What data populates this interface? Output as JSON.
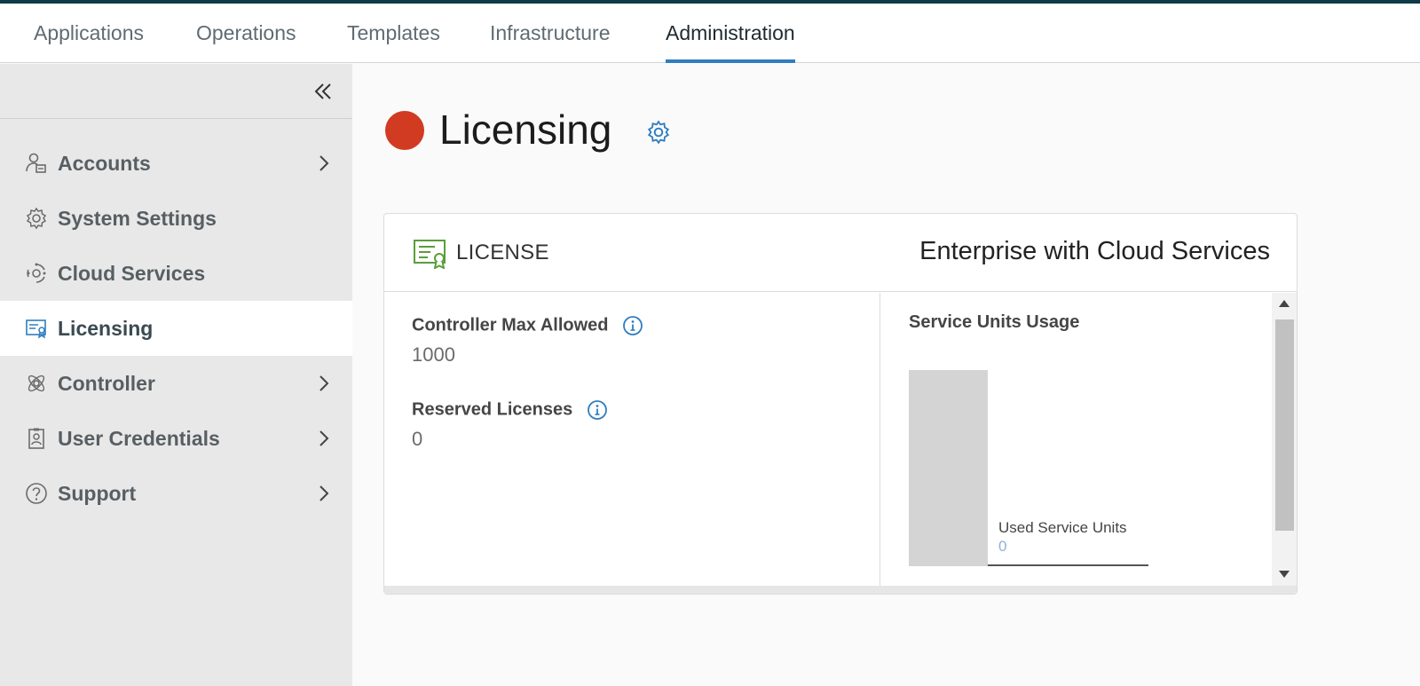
{
  "top_nav": {
    "tabs": [
      {
        "label": "Applications"
      },
      {
        "label": "Operations"
      },
      {
        "label": "Templates"
      },
      {
        "label": "Infrastructure"
      },
      {
        "label": "Administration"
      }
    ],
    "active_tab": "Administration",
    "accent_color": "#2f7dc0"
  },
  "sidebar": {
    "collapse_icon": "double-chevron-left-icon",
    "items": [
      {
        "label": "Accounts",
        "icon": "accounts-icon",
        "has_chevron": true
      },
      {
        "label": "System Settings",
        "icon": "gear-icon",
        "has_chevron": false
      },
      {
        "label": "Cloud Services",
        "icon": "cloud-services-icon",
        "has_chevron": false
      },
      {
        "label": "Licensing",
        "icon": "license-icon",
        "has_chevron": false,
        "active": true
      },
      {
        "label": "Controller",
        "icon": "controller-icon",
        "has_chevron": true
      },
      {
        "label": "User Credentials",
        "icon": "id-badge-icon",
        "has_chevron": true
      },
      {
        "label": "Support",
        "icon": "help-icon",
        "has_chevron": true
      }
    ]
  },
  "page": {
    "title": "Licensing",
    "status_color": "#d13b22"
  },
  "license_card": {
    "label": "LICENSE",
    "license_type": "Enterprise with Cloud Services",
    "controller_max_label": "Controller Max Allowed",
    "controller_max_value": "1000",
    "reserved_label": "Reserved Licenses",
    "reserved_value": "0",
    "usage": {
      "title": "Service Units Usage",
      "used_label": "Used Service Units",
      "used_value": "0"
    }
  }
}
